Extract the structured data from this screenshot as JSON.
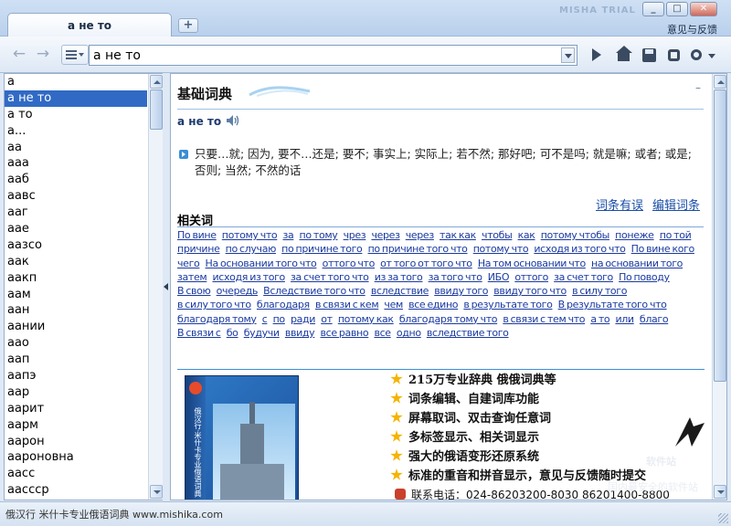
{
  "tab": {
    "title": "а не то",
    "new_tab_label": "+"
  },
  "window": {
    "brand": "MISHA TRIAL",
    "minimize": "_",
    "maximize": "□",
    "close": "✕",
    "feedback_link": "意见与反馈"
  },
  "toolbar": {
    "search_value": "а не то",
    "icons": [
      "back-icon",
      "forward-icon",
      "list-icon",
      "go-icon",
      "home-icon",
      "save-icon",
      "stop-icon",
      "tools-icon"
    ]
  },
  "word_list": [
    "а",
    "а не то",
    "а то",
    "а...",
    "аа",
    "ааа",
    "ааб",
    "аавс",
    "ааг",
    "аае",
    "аазсо",
    "аак",
    "аакп",
    "аам",
    "аан",
    "аании",
    "аао",
    "аап",
    "аапэ",
    "аар",
    "аарит",
    "аарм",
    "аарон",
    "аароновна",
    "аасс",
    "аассср"
  ],
  "word_list_selected": 1,
  "content": {
    "dict_title": "基础词典",
    "collapse_label": "–",
    "headword": "а не то",
    "definition": "只要…就; 因为, 要不…还是; 要不; 事实上; 实际上; 若不然; 那好吧; 可不是吗; 就是嘛; 或者; 或是; 否则; 当然; 不然的话",
    "report_error": "词条有误",
    "edit_entry": "编辑词条",
    "related_title": "相关词",
    "related_words": [
      "По вине",
      "потому что",
      "за",
      "по тому",
      "чрез",
      "через",
      "через",
      "так как",
      "чтобы",
      "как",
      "потому чтобы",
      "понеже",
      "по той",
      "причине",
      "по случаю",
      "по причине того",
      "по причине того что",
      "потому что",
      "исходя из того что",
      "По вине кого",
      "чего",
      "На основании того что",
      "оттого что",
      "от того от того что",
      "На том основании что",
      "на основании того",
      "затем",
      "исходя из того",
      "за счет того что",
      "из за того",
      "за того что",
      "ИБО",
      "оттого",
      "за счет того",
      "По поводу",
      "В свою",
      "очередь",
      "Вследствие того что",
      "вследствие",
      "ввиду того",
      "ввиду того что",
      "в силу того",
      "в силу того что",
      "благодаря",
      "в связи с кем",
      "чем",
      "все едино",
      "в результате того",
      "В результате того что",
      "благодаря тому",
      "с",
      "по",
      "ради",
      "от",
      "потому как",
      "благодаря тому что",
      "в связи с тем что",
      "а то",
      "или",
      "благо",
      "В связи с",
      "бо",
      "будучи",
      "ввиду",
      "все равно",
      "все",
      "одно",
      "вследствие того"
    ]
  },
  "advert": {
    "features": [
      "215万专业辞典 俄俄词典等",
      "词条编辑、自建词库功能",
      "屏幕取词、双击查询任意词",
      "多标签显示、相关词显示",
      "强大的俄语变形还原系统",
      "标准的重音和拼音显示，意见与反馈随时提交"
    ],
    "phone": "联系电话：024-86203200-8030     86201400-8800",
    "box_text": "俄汉行·米什卡专业俄语词典"
  },
  "watermark": {
    "line1": "软件站",
    "line2": "国内最安全的软件站"
  },
  "status_bar": {
    "text": "俄汉行 米什卡专业俄语词典 www.mishika.com"
  },
  "colors": {
    "link": "#1a3aa0",
    "selection": "#316ac5",
    "accent": "#3d8fd8"
  }
}
